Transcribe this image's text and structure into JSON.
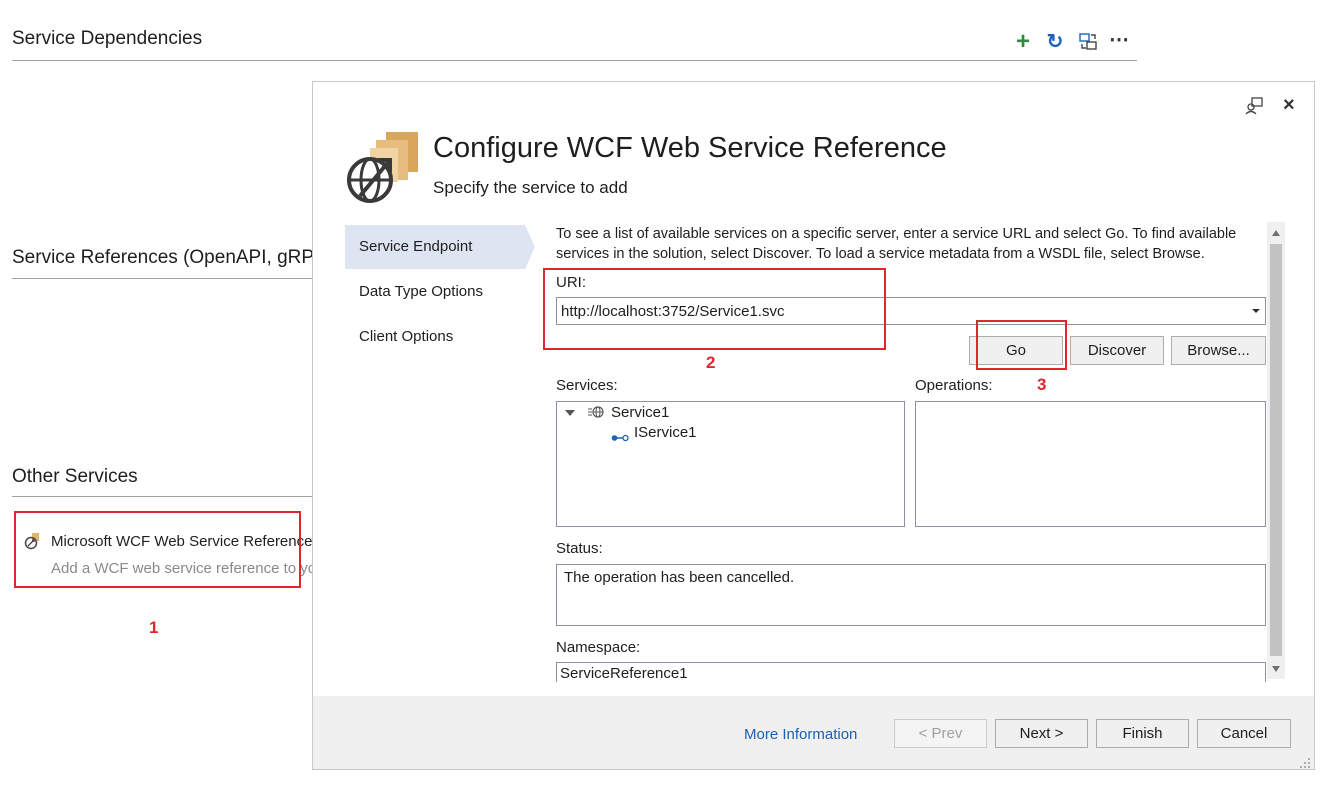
{
  "background": {
    "service_dependencies_title": "Service Dependencies",
    "service_references_title": "Service References (OpenAPI, gRPC",
    "other_services_title": "Other Services",
    "toolbar": {
      "add_icon": "plus-icon",
      "refresh_icon": "refresh-icon",
      "manage_icon": "manage-connections-icon",
      "more_icon": "ellipsis-icon"
    },
    "other_item": {
      "title": "Microsoft WCF Web Service Reference P",
      "description": "Add a WCF web service reference to yo"
    }
  },
  "annotations": {
    "marker1": "1",
    "marker2": "2",
    "marker3": "3",
    "color": "#e0262f"
  },
  "dialog": {
    "title": "Configure WCF Web Service Reference",
    "subtitle": "Specify the service to add",
    "nav": [
      {
        "label": "Service Endpoint",
        "active": true
      },
      {
        "label": "Data Type Options",
        "active": false
      },
      {
        "label": "Client Options",
        "active": false
      }
    ],
    "description": "To see a list of available services on a specific server, enter a service URL and select Go. To find available services in the solution, select Discover.  To load a service metadata from a WSDL file, select Browse.",
    "uri_label": "URI:",
    "uri_value": "http://localhost:3752/Service1.svc",
    "buttons": {
      "go": "Go",
      "discover": "Discover",
      "browse": "Browse..."
    },
    "services_label": "Services:",
    "operations_label": "Operations:",
    "services_tree": {
      "root": "Service1",
      "child": "IService1"
    },
    "status_label": "Status:",
    "status_text": "The operation has been cancelled.",
    "namespace_label": "Namespace:",
    "namespace_value": "ServiceReference1",
    "footer": {
      "more_info": "More Information",
      "prev": "< Prev",
      "next": "Next >",
      "finish": "Finish",
      "cancel": "Cancel"
    }
  }
}
